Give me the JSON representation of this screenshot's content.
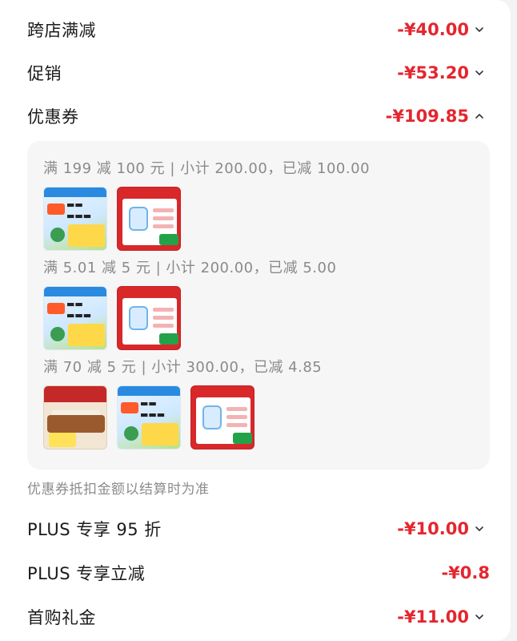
{
  "summary_rows": [
    {
      "label": "跨店满减",
      "amount": "-¥40.00",
      "chevron": "down"
    },
    {
      "label": "促销",
      "amount": "-¥53.20",
      "chevron": "down"
    },
    {
      "label": "优惠券",
      "amount": "-¥109.85",
      "chevron": "up"
    }
  ],
  "coupons": [
    {
      "rule": "满 199 减 100 元 | 小计 200.00，已减 100.00",
      "items": [
        "cold-medicine-product",
        "childrens-medicine-product"
      ]
    },
    {
      "rule": "满 5.01 减 5 元 | 小计 200.00，已减 5.00",
      "items": [
        "cold-medicine-product",
        "childrens-medicine-product"
      ]
    },
    {
      "rule": "满 70 减 5 元 | 小计 300.00，已减 4.85",
      "items": [
        "sofa-product",
        "cold-medicine-product",
        "childrens-medicine-product"
      ]
    }
  ],
  "coupon_note": "优惠券抵扣金额以结算时为准",
  "bottom_rows": [
    {
      "label": "PLUS 专享 95 折",
      "amount": "-¥10.00",
      "chevron": "down"
    },
    {
      "label": "PLUS 专享立减",
      "amount": "-¥0.8",
      "chevron": "none"
    },
    {
      "label": "首购礼金",
      "amount": "-¥11.00",
      "chevron": "down"
    }
  ],
  "colors": {
    "accent": "#e4262f",
    "text": "#1b1b1b",
    "muted": "#8a8a8a",
    "coupon_bg": "#f6f6f6"
  }
}
